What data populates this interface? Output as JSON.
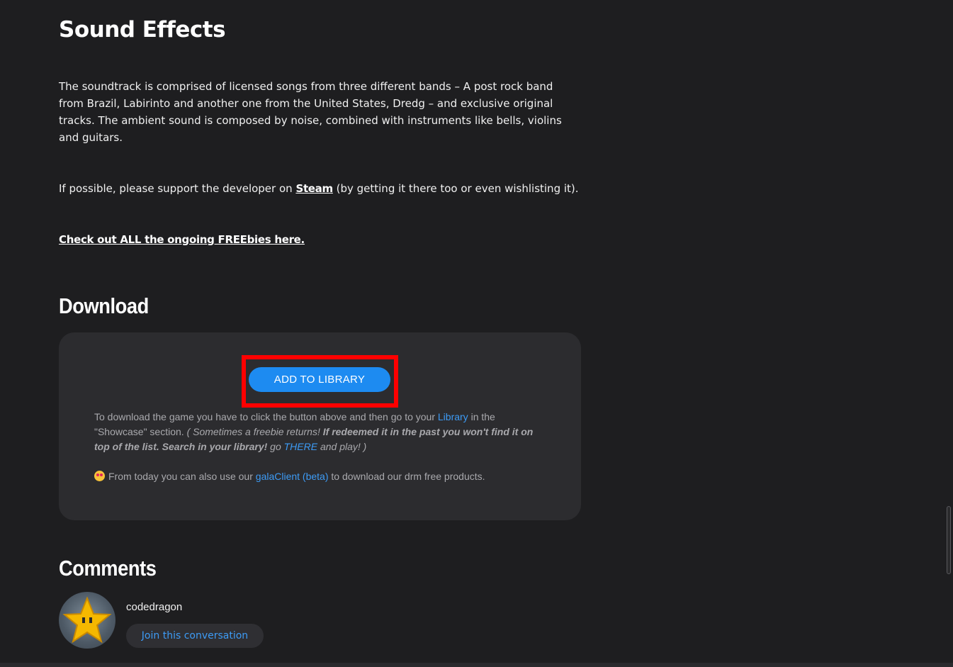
{
  "sound_effects": {
    "title": "Sound Effects",
    "paragraph": "The soundtrack is comprised of licensed songs from three different bands – A post rock band from Brazil, Labirinto and another one from the United States, Dredg – and exclusive original tracks. The ambient sound is composed by noise, combined with instruments like bells, violins and guitars.",
    "support_prefix": "If possible, please support the developer on ",
    "steam_link": "Steam",
    "support_suffix": " (by getting it there too or even wishlisting it).",
    "freebies_link": "Check out ALL the ongoing FREEbies here."
  },
  "download": {
    "title": "Download",
    "add_button": "ADD TO LIBRARY",
    "text_prefix": "To download the game you have to click the button above and then go to your ",
    "library_link": "Library",
    "text_mid": " in the \"Showcase\" section. ",
    "italic1": "( Sometimes a freebie returns! ",
    "bold_italic": "If redeemed it in the past you won't find it on top of the list. Search in your library!",
    "italic2": " go ",
    "there_link": "THERE",
    "italic3": " and play! )",
    "client_prefix": "From today you can also use our ",
    "client_link": "galaClient (beta)",
    "client_suffix": " to download our drm free products.",
    "emoji_icon": "star-struck-emoji-icon"
  },
  "comments": {
    "title": "Comments",
    "username": "codedragon",
    "join_button": "Join this conversation",
    "avatar_icon": "star-icon"
  },
  "colors": {
    "background": "#1e1e20",
    "box": "#2c2c2f",
    "accent_blue": "#1d8bf1",
    "link_blue": "#3d9bf5",
    "highlight_red": "#ff0000"
  }
}
